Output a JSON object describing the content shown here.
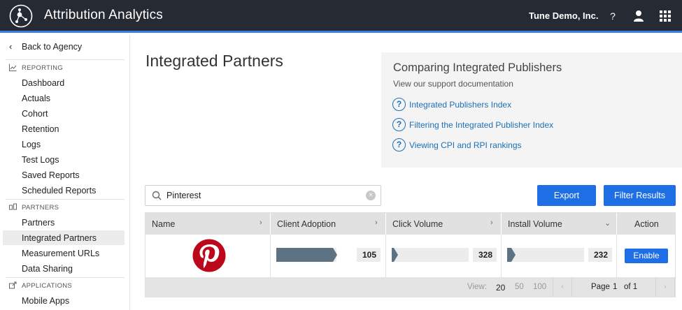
{
  "header": {
    "app_title": "Attribution Analytics",
    "org_name": "Tune Demo, Inc.",
    "help_label": "?",
    "icons": [
      "logo-icon",
      "user-icon",
      "apps-grid-icon"
    ]
  },
  "sidebar": {
    "back_label": "Back to Agency",
    "sections": [
      {
        "label": "REPORTING",
        "icon": "chart-icon",
        "items": [
          "Dashboard",
          "Actuals",
          "Cohort",
          "Retention",
          "Logs",
          "Test Logs",
          "Saved Reports",
          "Scheduled Reports"
        ]
      },
      {
        "label": "PARTNERS",
        "icon": "partners-icon",
        "items": [
          "Partners",
          "Integrated Partners",
          "Measurement URLs",
          "Data Sharing"
        ]
      },
      {
        "label": "APPLICATIONS",
        "icon": "external-link-icon",
        "items": [
          "Mobile Apps"
        ]
      }
    ],
    "active_item": "Integrated Partners"
  },
  "main": {
    "title": "Integrated Partners",
    "info": {
      "title": "Comparing Integrated Publishers",
      "subtitle": "View our support documentation",
      "links": [
        "Integrated Publishers Index",
        "Filtering the Integrated Publisher Index",
        "Viewing CPI and RPI rankings"
      ]
    },
    "search": {
      "value": "Pinterest",
      "clear_label": "×"
    },
    "buttons": {
      "export": "Export",
      "filter": "Filter Results"
    },
    "table": {
      "columns": [
        "Name",
        "Client Adoption",
        "Click Volume",
        "Install Volume",
        "Action"
      ],
      "rows": [
        {
          "name_icon": "pinterest-logo",
          "client_adoption": "105",
          "click_volume": "328",
          "install_volume": "232",
          "action": "Enable",
          "client_adoption_fill": 0.78,
          "click_volume_fill": 0.08,
          "install_volume_fill": 0.11
        }
      ],
      "footer": {
        "view_label": "View:",
        "page_sizes": [
          "20",
          "50",
          "100"
        ],
        "selected_size": "20",
        "page_label": "Page",
        "page_value": "1",
        "of_label": "of 1",
        "prev_label": "‹",
        "next_label": "›"
      }
    },
    "colors": {
      "accent": "#1e6fe6",
      "bar_dark": "#5d7383",
      "pinterest": "#bd081c"
    }
  }
}
